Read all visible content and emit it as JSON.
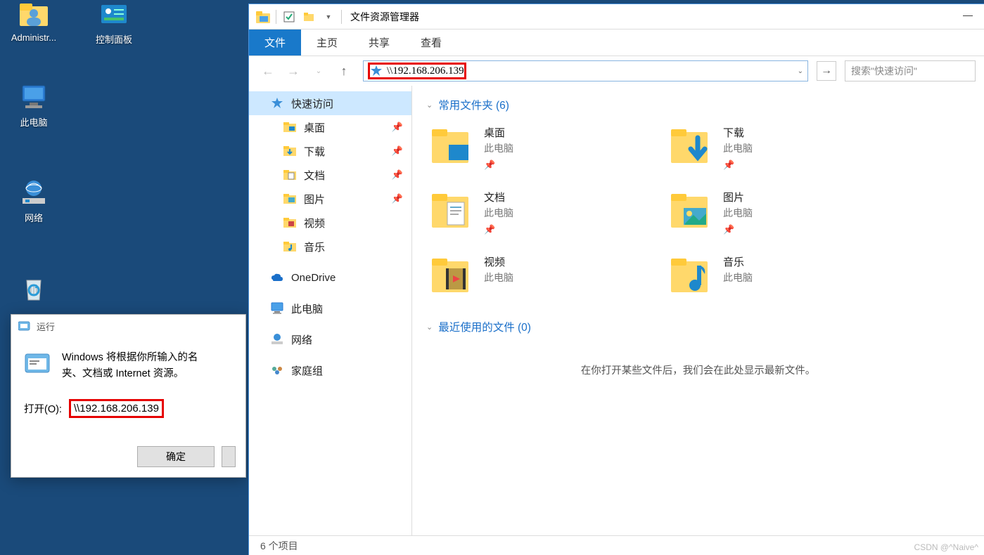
{
  "desktop": {
    "icons": [
      {
        "name": "Administr...",
        "kind": "user"
      },
      {
        "name": "控制面板",
        "kind": "control-panel"
      },
      {
        "name": "此电脑",
        "kind": "this-pc"
      },
      {
        "name": "网络",
        "kind": "network"
      },
      {
        "name": "",
        "kind": "recycle-bin"
      }
    ]
  },
  "run": {
    "title": "运行",
    "description": "Windows 将根据你所输入的名\n夹、文档或 Internet 资源。",
    "open_label": "打开(O):",
    "value": "\\\\192.168.206.139",
    "ok": "确定",
    "cancel": ""
  },
  "explorer": {
    "title": "文件资源管理器",
    "tabs": {
      "file": "文件",
      "home": "主页",
      "share": "共享",
      "view": "查看"
    },
    "address": "\\\\192.168.206.139",
    "search_placeholder": "搜索\"快速访问\"",
    "sidebar": {
      "quick_access": "快速访问",
      "items": [
        {
          "label": "桌面",
          "icon": "desktop",
          "pin": true
        },
        {
          "label": "下载",
          "icon": "download",
          "pin": true
        },
        {
          "label": "文档",
          "icon": "document",
          "pin": true
        },
        {
          "label": "图片",
          "icon": "picture",
          "pin": true
        },
        {
          "label": "视频",
          "icon": "video",
          "pin": false
        },
        {
          "label": "音乐",
          "icon": "music",
          "pin": false
        }
      ],
      "onedrive": "OneDrive",
      "thispc": "此电脑",
      "network": "网络",
      "homegroup": "家庭组"
    },
    "sections": {
      "frequent": "常用文件夹 (6)",
      "recent": "最近使用的文件 (0)"
    },
    "tiles": [
      {
        "name": "桌面",
        "loc": "此电脑",
        "pin": true,
        "kind": "desktop"
      },
      {
        "name": "下载",
        "loc": "此电脑",
        "pin": true,
        "kind": "download"
      },
      {
        "name": "文档",
        "loc": "此电脑",
        "pin": true,
        "kind": "document"
      },
      {
        "name": "图片",
        "loc": "此电脑",
        "pin": true,
        "kind": "picture"
      },
      {
        "name": "视频",
        "loc": "此电脑",
        "pin": false,
        "kind": "video"
      },
      {
        "name": "音乐",
        "loc": "此电脑",
        "pin": false,
        "kind": "music"
      }
    ],
    "recent_empty": "在你打开某些文件后，我们会在此处显示最新文件。",
    "status": "6 个项目"
  },
  "watermark": "CSDN @^Naive^"
}
